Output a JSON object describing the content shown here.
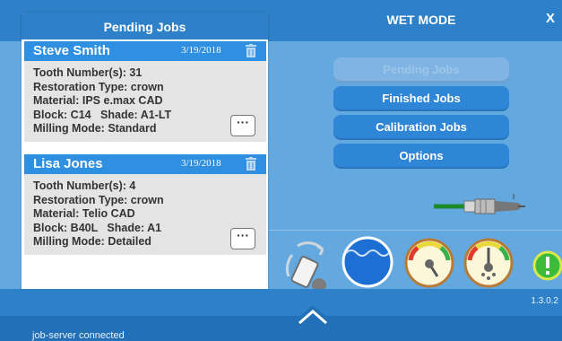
{
  "header": {
    "mode_title": "WET MODE",
    "close_label": "X"
  },
  "pending_panel": {
    "title": "Pending Jobs",
    "jobs": [
      {
        "name": "Steve Smith",
        "date": "3/19/2018",
        "lines": [
          "Tooth Number(s): 31",
          "Restoration Type: crown",
          "Material: IPS e.max CAD",
          "Block: C14   Shade: A1-LT",
          "Milling Mode: Standard"
        ],
        "more_label": "···"
      },
      {
        "name": "Lisa Jones",
        "date": "3/19/2018",
        "lines": [
          "Tooth Number(s): 4",
          "Restoration Type: crown",
          "Material: Telio CAD",
          "Block: B40L   Shade: A1",
          "Milling Mode: Detailed"
        ],
        "more_label": "···"
      }
    ]
  },
  "side_buttons": {
    "pending": "Pending Jobs",
    "finished": "Finished Jobs",
    "calibration": "Calibration Jobs",
    "options": "Options"
  },
  "status": {
    "version": "1.3.0.2",
    "connection": "job-server connected"
  },
  "icons": {
    "tool": "milling-tool-icon",
    "rotate_device": "rotate-device-icon",
    "water_level": "water-level-icon",
    "gauge_1": "pressure-gauge-icon",
    "gauge_2": "dust-gauge-icon",
    "alert": "alert-icon"
  },
  "colors": {
    "accent": "#2e80c8",
    "background": "#63a9e0",
    "card_header": "#2f8fe0",
    "card_body": "#e4e4e4",
    "alert_green": "#3dbb3a"
  }
}
